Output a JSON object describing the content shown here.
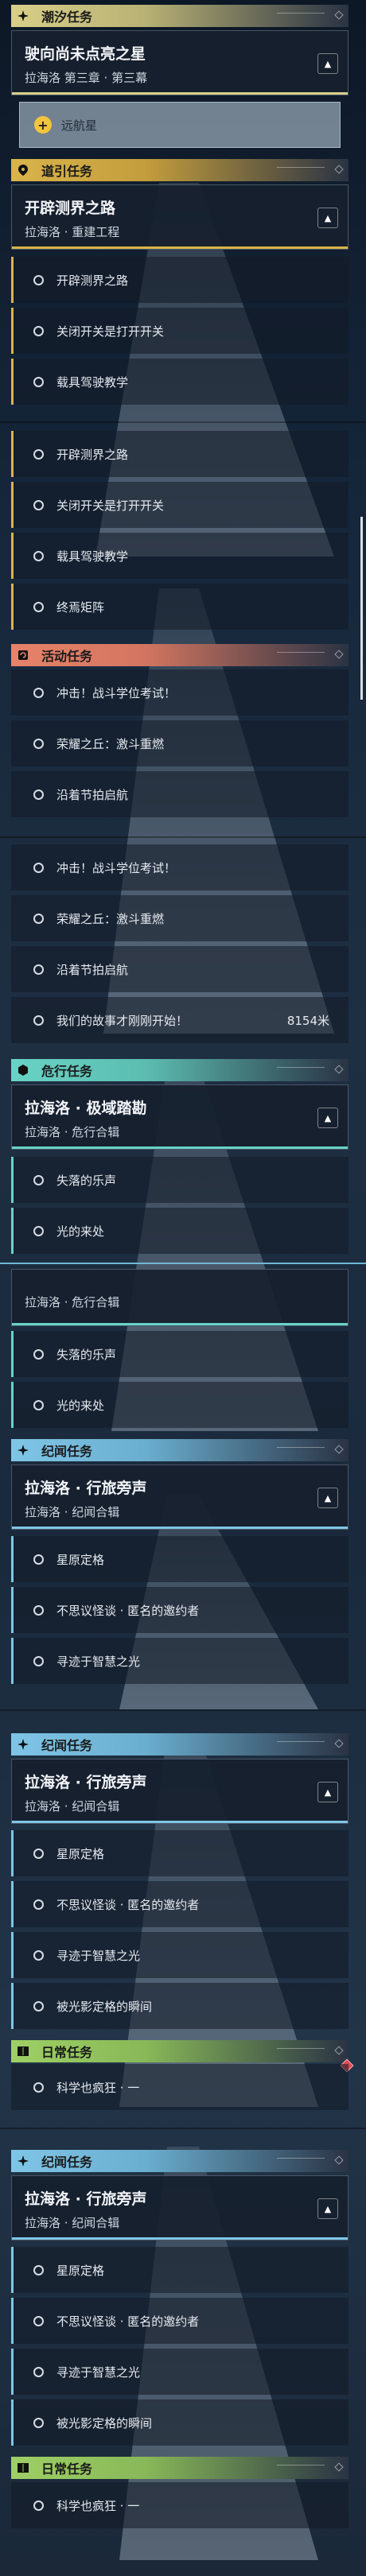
{
  "colors": {
    "chao_xi": "#d8cf88",
    "dao_yin": "#d9b44a",
    "huo_dong": "#e8826a",
    "wei_xing": "#68d3c6",
    "ji_wen": "#7fc5e6",
    "ri_chang": "#9ed065"
  },
  "chaoxi": {
    "header": "潮汐任务",
    "icon": "four-point-star-icon",
    "quest_title": "驶向尚未点亮之星",
    "quest_sub": "拉海洛 第三章 · 第三幕",
    "selected": "远航星"
  },
  "daoyin": {
    "header": "道引任务",
    "icon": "location-pin-icon",
    "quest_title": "开辟测界之路",
    "quest_sub": "拉海洛 · 重建工程",
    "items": [
      "开辟测界之路",
      "关闭开关是打开开关",
      "载具驾驶教学"
    ]
  },
  "daoyin_list2": [
    "开辟测界之路",
    "关闭开关是打开开关",
    "载具驾驶教学",
    "终焉矩阵"
  ],
  "huodong": {
    "header": "活动任务",
    "icon": "refresh-icon",
    "items": [
      "冲击！战斗学位考试！",
      "荣耀之丘：激斗重燃",
      "沿着节拍启航"
    ]
  },
  "huodong_list2": {
    "items": [
      "冲击！战斗学位考试！",
      "荣耀之丘：激斗重燃",
      "沿着节拍启航"
    ],
    "last_item": "我们的故事才刚刚开始！",
    "last_dist": "8154米"
  },
  "weixing": {
    "header": "危行任务",
    "icon": "hexagon-icon",
    "quest_title": "拉海洛 · 极域踏勘",
    "quest_sub": "拉海洛 · 危行合辑",
    "items": [
      "失落的乐声",
      "光的来处"
    ]
  },
  "weixing2": {
    "quest_sub": "拉海洛 · 危行合辑",
    "items": [
      "失落的乐声",
      "光的来处"
    ]
  },
  "jiwen1": {
    "header": "纪闻任务",
    "icon": "four-point-star-icon",
    "quest_title": "拉海洛 · 行旅旁声",
    "quest_sub": "拉海洛 · 纪闻合辑",
    "items": [
      "星原定格",
      "不思议怪谈 · 匿名的邀约者",
      "寻迹于智慧之光"
    ]
  },
  "jiwen2": {
    "header": "纪闻任务",
    "icon": "four-point-star-icon",
    "quest_title": "拉海洛 · 行旅旁声",
    "quest_sub": "拉海洛 · 纪闻合辑",
    "items": [
      "星原定格",
      "不思议怪谈 · 匿名的邀约者",
      "寻迹于智慧之光",
      "被光影定格的瞬间"
    ]
  },
  "richang1": {
    "header": "日常任务",
    "icon": "book-icon",
    "items": [
      "科学也疯狂 · 一"
    ]
  },
  "jiwen3": {
    "header": "纪闻任务",
    "icon": "four-point-star-icon",
    "quest_title": "拉海洛 · 行旅旁声",
    "quest_sub": "拉海洛 · 纪闻合辑",
    "items": [
      "星原定格",
      "不思议怪谈 · 匿名的邀约者",
      "寻迹于智慧之光",
      "被光影定格的瞬间"
    ]
  },
  "richang2": {
    "header": "日常任务",
    "icon": "book-icon",
    "items": [
      "科学也疯狂 · 一"
    ]
  }
}
